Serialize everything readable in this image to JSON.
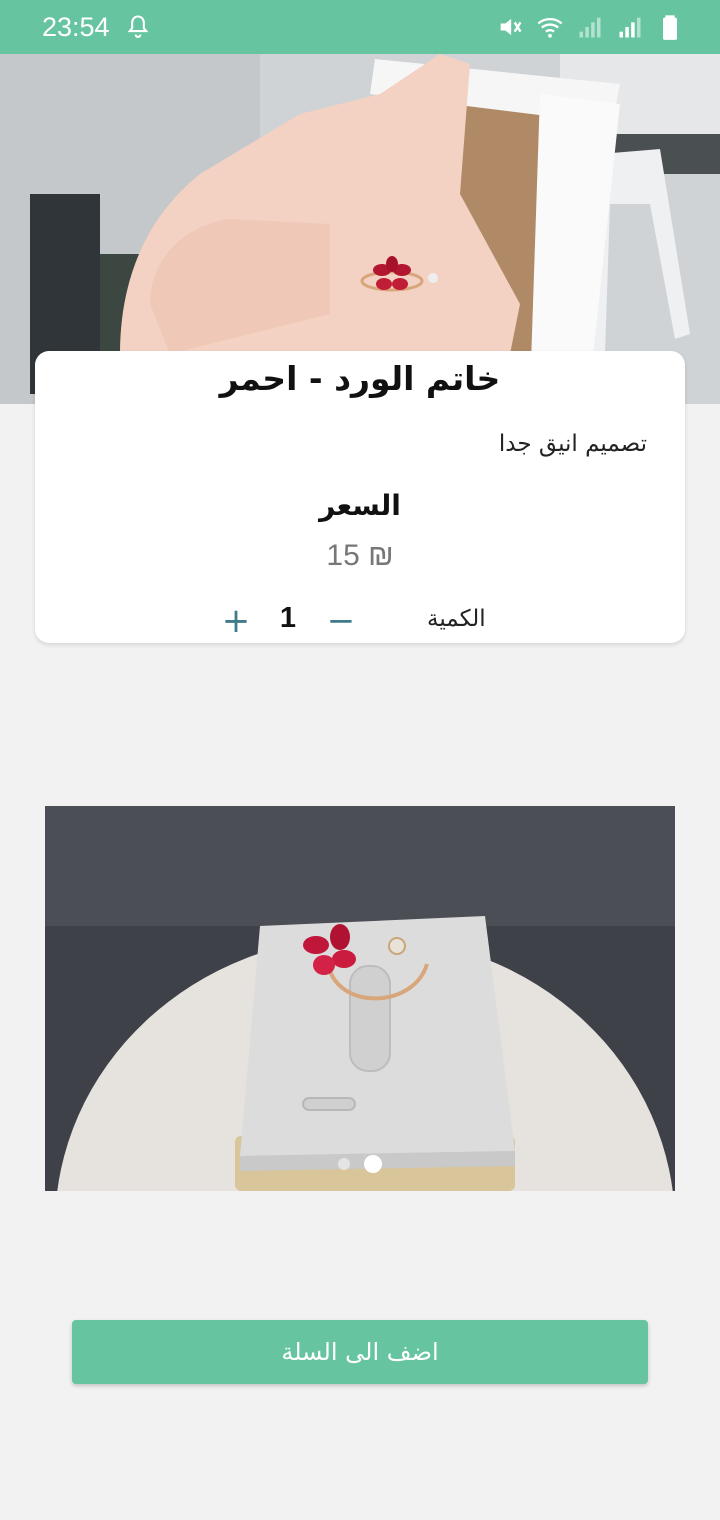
{
  "colors": {
    "accent": "#66c5a0",
    "qty_controls": "#3f7b8a"
  },
  "status_bar": {
    "time": "23:54",
    "icons": [
      "notification-bell-icon",
      "mute-icon",
      "wifi-icon",
      "signal-icon",
      "signal-icon",
      "battery-icon"
    ]
  },
  "product": {
    "title": "خاتم الورد - احمر",
    "description": "تصميم انيق جدا",
    "price_label": "السعر",
    "price_value": "15 ₪",
    "quantity_label": "الكمية",
    "quantity": "1",
    "minus_symbol": "−",
    "plus_symbol": "+"
  },
  "gallery": {
    "image_count": 2,
    "active_index": 1
  },
  "actions": {
    "add_to_cart": "اضف الى السلة"
  }
}
